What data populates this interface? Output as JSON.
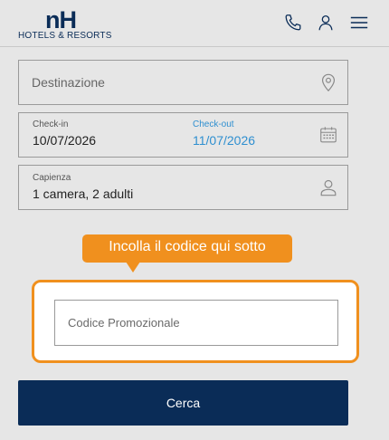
{
  "header": {
    "logo_mark": "nH",
    "logo_sub": "HOTELS & RESORTS",
    "icons": [
      "phone-icon",
      "user-icon",
      "menu-icon"
    ]
  },
  "form": {
    "destination": {
      "placeholder": "Destinazione",
      "icon": "map-pin-icon"
    },
    "dates": {
      "checkin_label": "Check-in",
      "checkin_value": "10/07/2026",
      "checkout_label": "Check-out",
      "checkout_value": "11/07/2026",
      "icon": "calendar-icon"
    },
    "capacity": {
      "label": "Capienza",
      "value": "1 camera, 2 adulti",
      "icon": "person-icon"
    },
    "promo": {
      "tooltip": "Incolla il codice qui sotto",
      "placeholder": "Codice Promozionale"
    },
    "search_button": "Cerca"
  },
  "colors": {
    "brand_navy": "#0a2c57",
    "accent_orange": "#f0901e",
    "checkout_blue": "#2e8fd0",
    "background": "#e6e6e6"
  }
}
